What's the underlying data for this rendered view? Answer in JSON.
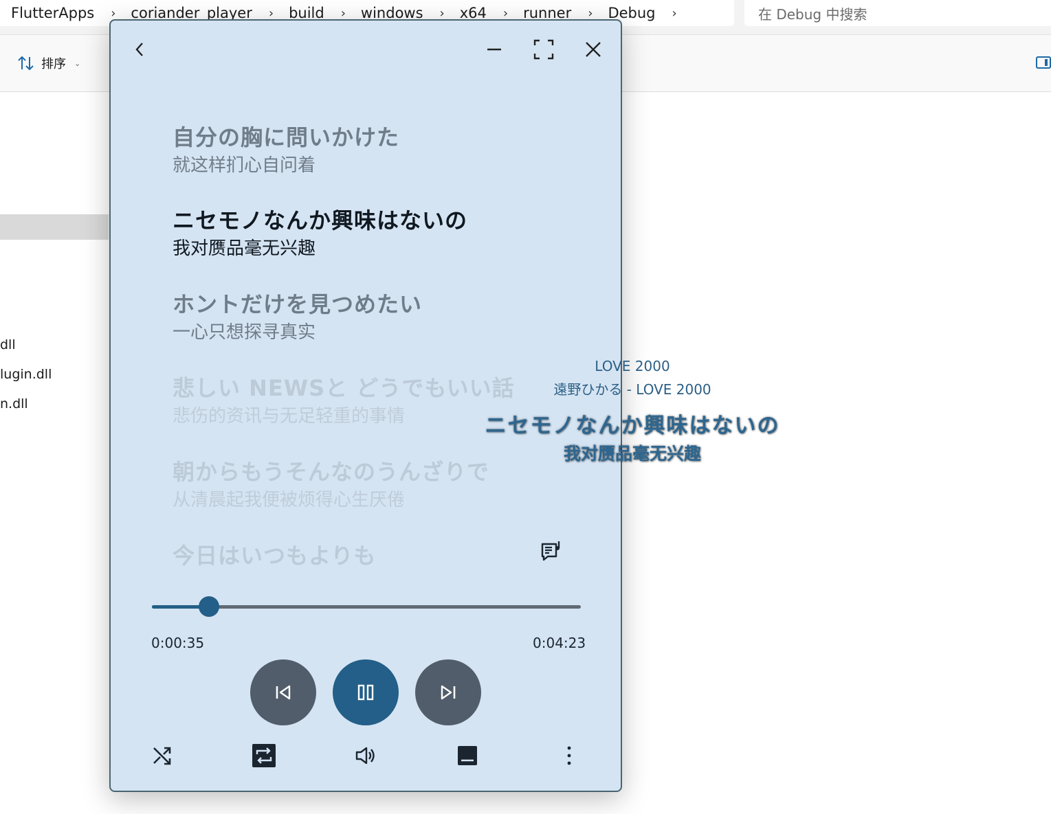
{
  "explorer": {
    "breadcrumb": [
      "FlutterApps",
      "coriander_player",
      "build",
      "windows",
      "x64",
      "runner",
      "Debug"
    ],
    "search_placeholder": "在 Debug 中搜索",
    "sort_label": "排序",
    "files": [
      "dll",
      "lugin.dll",
      "n.dll"
    ]
  },
  "player": {
    "lyrics": [
      {
        "text": "自分の胸に問いかけた",
        "translation": "就这样扪心自问着",
        "state": "past"
      },
      {
        "text": "ニセモノなんか興味はないの",
        "translation": "我对赝品毫无兴趣",
        "state": "current"
      },
      {
        "text": "ホントだけを見つめたい",
        "translation": "一心只想探寻真实",
        "state": "next"
      },
      {
        "text": "悲しい NEWSと どうでもいい話",
        "translation": "悲伤的资讯与无足轻重的事情",
        "state": "upcoming"
      },
      {
        "text": "朝からもうそんなのうんざりで",
        "translation": "从清晨起我便被烦得心生厌倦",
        "state": "upcoming"
      },
      {
        "text": "今日はいつもよりも",
        "translation": "",
        "state": "upcoming"
      }
    ],
    "position": "0:00:35",
    "duration": "0:04:23",
    "progress_fraction": 0.133,
    "colors": {
      "accent": "#235f88",
      "secondary_button": "#515d6a",
      "background": "#d5e4f3"
    }
  },
  "desktop_lyric": {
    "title": "LOVE 2000",
    "artist_title": "遠野ひかる - LOVE 2000",
    "line": "ニセモノなんか興味はないの",
    "translation": "我对赝品毫无兴趣"
  }
}
